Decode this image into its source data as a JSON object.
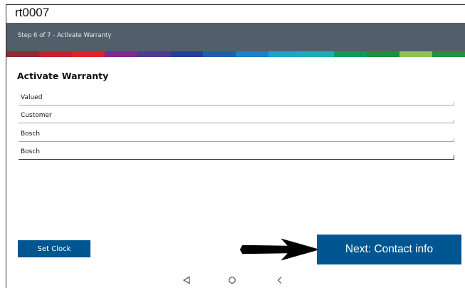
{
  "window": {
    "title": "rt0007"
  },
  "header": {
    "step_text": "Step 6 of 7 - Activate Warranty"
  },
  "brand_stripe_colors": [
    "#8f2a2f",
    "#c5202f",
    "#e0202a",
    "#7b2d8b",
    "#4f3a92",
    "#243f93",
    "#1f5fae",
    "#1b82c4",
    "#18a7c9",
    "#18b1b3",
    "#0f9a5a",
    "#1d8f3d",
    "#8fc252",
    "#1f9140"
  ],
  "main": {
    "title": "Activate Warranty",
    "fields": [
      {
        "value": "Valued"
      },
      {
        "value": "Customer"
      },
      {
        "value": "Bosch"
      },
      {
        "value": "Bosch"
      }
    ]
  },
  "buttons": {
    "set_clock": "Set Clock",
    "next": "Next: Contact info"
  },
  "nav": {
    "icons": [
      "back-triangle-icon",
      "home-circle-icon",
      "back-chevron-icon"
    ]
  },
  "colors": {
    "header_bg": "#525f6b",
    "button_bg": "#005691",
    "button_text": "#ffffff"
  }
}
